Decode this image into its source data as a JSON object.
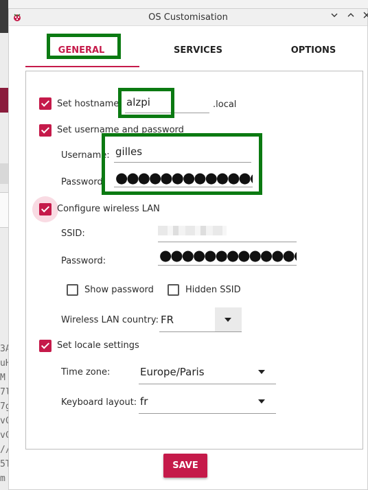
{
  "window": {
    "title": "OS Customisation"
  },
  "tabs": [
    {
      "label": "GENERAL",
      "active": true
    },
    {
      "label": "SERVICES",
      "active": false
    },
    {
      "label": "OPTIONS",
      "active": false
    }
  ],
  "general": {
    "hostname": {
      "label": "Set hostname:",
      "checked": true,
      "value": "alzpi",
      "suffix": ".local"
    },
    "user": {
      "label": "Set username and password",
      "checked": true,
      "username_label": "Username:",
      "username_value": "gilles",
      "password_label": "Password:",
      "password_mask": "●●●●●●●●●●●●●●"
    },
    "wlan": {
      "label": "Configure wireless LAN",
      "checked": true,
      "ssid_label": "SSID:",
      "password_label": "Password:",
      "password_mask": "●●●●●●●●●●●●●●●",
      "show_password_label": "Show password",
      "hidden_ssid_label": "Hidden SSID",
      "country_label": "Wireless LAN country:",
      "country_value": "FR"
    },
    "locale": {
      "label": "Set locale settings",
      "checked": true,
      "timezone_label": "Time zone:",
      "timezone_value": "Europe/Paris",
      "keyboard_label": "Keyboard layout:",
      "keyboard_value": "fr"
    }
  },
  "save_label": "SAVE",
  "colors": {
    "accent": "#c51a4a",
    "highlight": "#0b7a12"
  },
  "background": {
    "terminal_text": "3A\nuH\nM\n7l\n7g\nvC\nvC\n//\n5T\nm"
  }
}
